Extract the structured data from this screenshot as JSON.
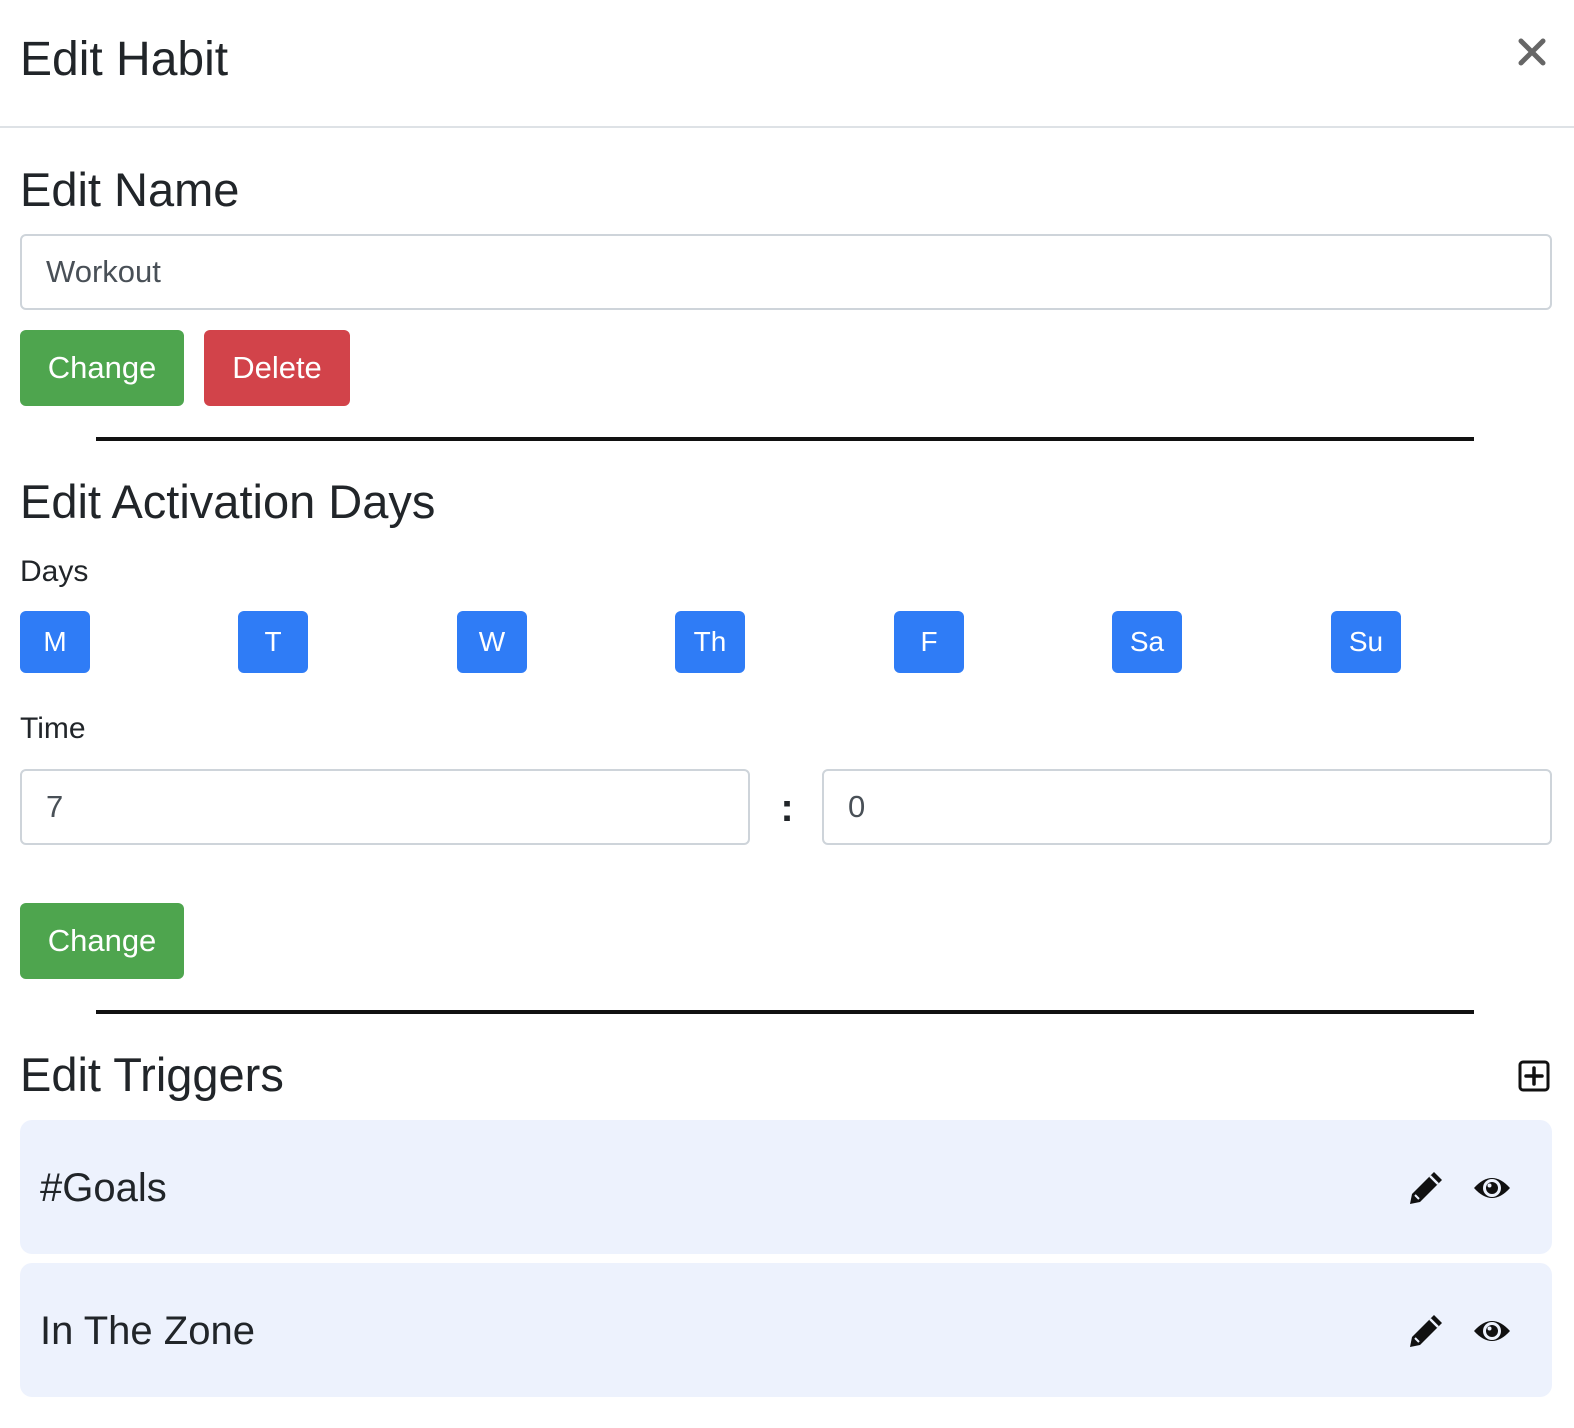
{
  "modal": {
    "title": "Edit Habit",
    "close_icon": "close-icon"
  },
  "name_section": {
    "title": "Edit Name",
    "name_value": "Workout",
    "change_label": "Change",
    "delete_label": "Delete"
  },
  "activation_section": {
    "title": "Edit Activation Days",
    "days_label": "Days",
    "days": [
      "M",
      "T",
      "W",
      "Th",
      "F",
      "Sa",
      "Su"
    ],
    "time_label": "Time",
    "hour_value": "7",
    "separator": ":",
    "minute_value": "0",
    "change_label": "Change"
  },
  "triggers_section": {
    "title": "Edit Triggers",
    "add_icon": "plus-square-icon",
    "items": [
      {
        "name": "#Goals",
        "edit_icon": "pencil-icon",
        "view_icon": "eye-icon"
      },
      {
        "name": "In The Zone",
        "edit_icon": "pencil-icon",
        "view_icon": "eye-icon"
      }
    ]
  },
  "colors": {
    "success": "#4ea54e",
    "danger": "#d2434a",
    "primary": "#2f7cf6",
    "trigger_background": "#edf2fd"
  }
}
